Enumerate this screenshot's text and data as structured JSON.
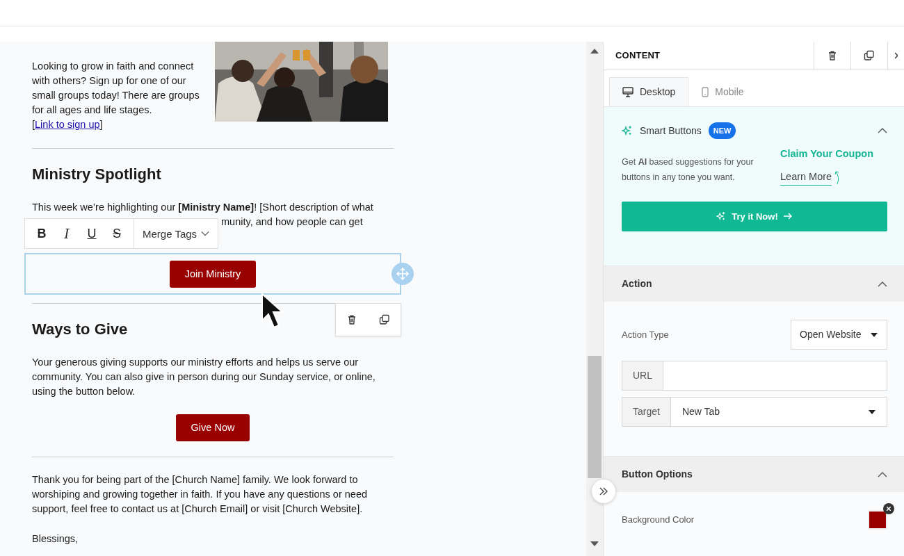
{
  "email": {
    "intro": {
      "text": "Looking to grow in faith and connect with others? Sign up for one of our small groups today! There are groups for all ages and life stages.",
      "link_open": "[",
      "link": "Link to sign up",
      "link_close": "]"
    },
    "spotlight": {
      "heading": "Ministry Spotlight",
      "line_1": "This week we’re highlighting our **[Ministry Name]**! [Short description of what",
      "line_2": "munity, and how people can get",
      "button": {
        "label": "Join Ministry",
        "selected": true
      }
    },
    "give": {
      "heading": "Ways to Give",
      "text": "Your generous giving supports our ministry efforts and helps us serve our community. You can also give in person during our Sunday service, or online, using the button below.",
      "button": {
        "label": "Give Now",
        "selected": false
      }
    },
    "closing": "Thank you for being part of the [Church Name] family. We look forward to worshiping and growing together in faith. If you have any questions or need support, feel free to contact us at [Church Email] or visit [Church Website].",
    "signoff": "Blessings,"
  },
  "format_toolbar": {
    "buttons": [
      {
        "kind": "bold",
        "label": "B"
      },
      {
        "kind": "italic",
        "label": "I"
      },
      {
        "kind": "underline",
        "label": "U"
      },
      {
        "kind": "strike",
        "label": "S"
      }
    ],
    "merge_tags": "Merge Tags"
  },
  "panel": {
    "title": "CONTENT",
    "tabs": [
      {
        "label": "Desktop",
        "kind": "desktop",
        "selected": true
      },
      {
        "label": "Mobile",
        "kind": "mobile",
        "selected": false
      }
    ],
    "smart": {
      "title": "Smart Buttons",
      "badge": "NEW",
      "expanded": true,
      "text": "Get **AI** based suggestions for your buttons in any tone you want.",
      "claim": "Claim Your Coupon",
      "learn": "Learn More",
      "cta": "Try it Now!"
    },
    "sections": [
      {
        "kind": "action",
        "title": "Action",
        "expanded": true,
        "action_type": {
          "label": "Action Type",
          "value": "Open Website"
        },
        "url": {
          "label": "URL"
        },
        "target": {
          "label": "Target",
          "value": "New Tab"
        }
      },
      {
        "kind": "button_options",
        "title": "Button Options",
        "expanded": true,
        "background": {
          "label": "Background Color",
          "color": "#990000"
        }
      }
    ]
  }
}
